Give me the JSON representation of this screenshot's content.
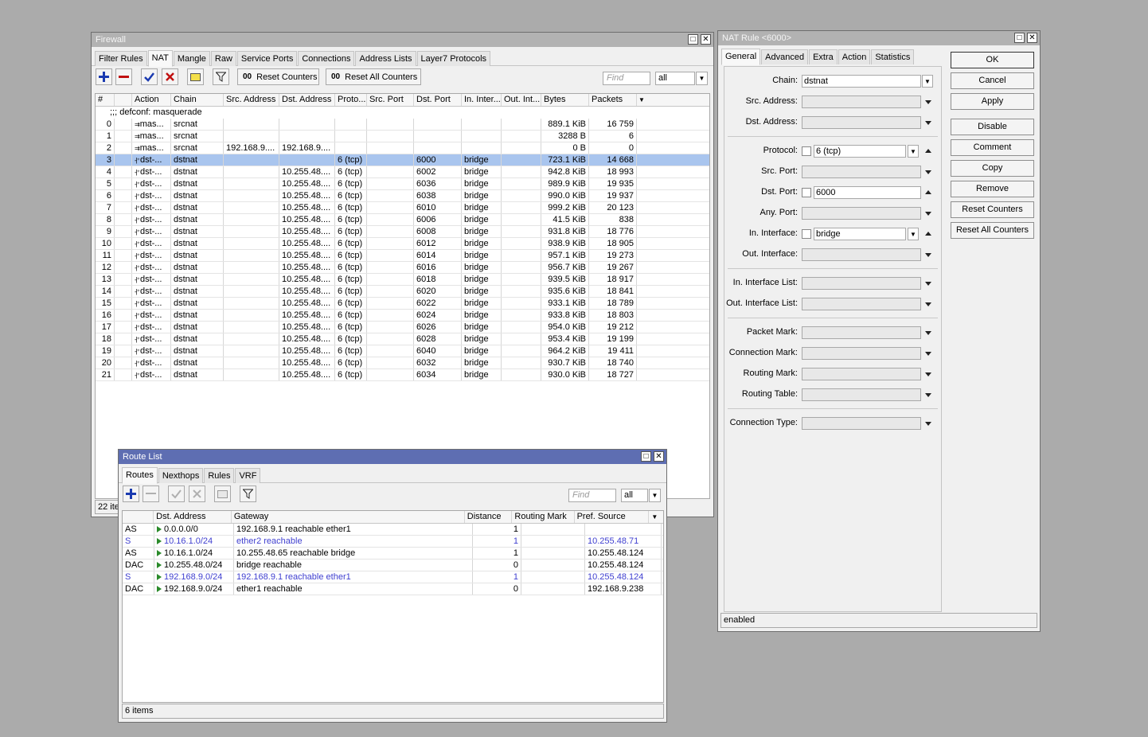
{
  "firewall": {
    "title": "Firewall",
    "tabs": [
      "Filter Rules",
      "NAT",
      "Mangle",
      "Raw",
      "Service Ports",
      "Connections",
      "Address Lists",
      "Layer7 Protocols"
    ],
    "reset_counters": "Reset Counters",
    "reset_all_counters": "Reset All Counters",
    "counter_icon": "00",
    "find_placeholder": "Find",
    "filter_value": "all",
    "columns": [
      "#",
      "",
      "Action",
      "Chain",
      "Src. Address",
      "Dst. Address",
      "Proto...",
      "Src. Port",
      "Dst. Port",
      "In. Inter...",
      "Out. Int...",
      "Bytes",
      "Packets"
    ],
    "comment": ";;; defconf: masquerade",
    "rows": [
      [
        "0",
        "",
        "mas...",
        "srcnat",
        "",
        "",
        "",
        "",
        "",
        "",
        "",
        "889.1 KiB",
        "16 759"
      ],
      [
        "1",
        "",
        "mas...",
        "srcnat",
        "",
        "",
        "",
        "",
        "",
        "",
        "",
        "3288 B",
        "6"
      ],
      [
        "2",
        "",
        "mas...",
        "srcnat",
        "192.168.9....",
        "192.168.9....",
        "",
        "",
        "",
        "",
        "",
        "0 B",
        "0"
      ],
      [
        "3",
        "",
        "dst-...",
        "dstnat",
        "",
        "",
        "6 (tcp)",
        "",
        "6000",
        "bridge",
        "",
        "723.1 KiB",
        "14 668"
      ],
      [
        "4",
        "",
        "dst-...",
        "dstnat",
        "",
        "10.255.48....",
        "6 (tcp)",
        "",
        "6002",
        "bridge",
        "",
        "942.8 KiB",
        "18 993"
      ],
      [
        "5",
        "",
        "dst-...",
        "dstnat",
        "",
        "10.255.48....",
        "6 (tcp)",
        "",
        "6036",
        "bridge",
        "",
        "989.9 KiB",
        "19 935"
      ],
      [
        "6",
        "",
        "dst-...",
        "dstnat",
        "",
        "10.255.48....",
        "6 (tcp)",
        "",
        "6038",
        "bridge",
        "",
        "990.0 KiB",
        "19 937"
      ],
      [
        "7",
        "",
        "dst-...",
        "dstnat",
        "",
        "10.255.48....",
        "6 (tcp)",
        "",
        "6010",
        "bridge",
        "",
        "999.2 KiB",
        "20 123"
      ],
      [
        "8",
        "",
        "dst-...",
        "dstnat",
        "",
        "10.255.48....",
        "6 (tcp)",
        "",
        "6006",
        "bridge",
        "",
        "41.5 KiB",
        "838"
      ],
      [
        "9",
        "",
        "dst-...",
        "dstnat",
        "",
        "10.255.48....",
        "6 (tcp)",
        "",
        "6008",
        "bridge",
        "",
        "931.8 KiB",
        "18 776"
      ],
      [
        "10",
        "",
        "dst-...",
        "dstnat",
        "",
        "10.255.48....",
        "6 (tcp)",
        "",
        "6012",
        "bridge",
        "",
        "938.9 KiB",
        "18 905"
      ],
      [
        "11",
        "",
        "dst-...",
        "dstnat",
        "",
        "10.255.48....",
        "6 (tcp)",
        "",
        "6014",
        "bridge",
        "",
        "957.1 KiB",
        "19 273"
      ],
      [
        "12",
        "",
        "dst-...",
        "dstnat",
        "",
        "10.255.48....",
        "6 (tcp)",
        "",
        "6016",
        "bridge",
        "",
        "956.7 KiB",
        "19 267"
      ],
      [
        "13",
        "",
        "dst-...",
        "dstnat",
        "",
        "10.255.48....",
        "6 (tcp)",
        "",
        "6018",
        "bridge",
        "",
        "939.5 KiB",
        "18 917"
      ],
      [
        "14",
        "",
        "dst-...",
        "dstnat",
        "",
        "10.255.48....",
        "6 (tcp)",
        "",
        "6020",
        "bridge",
        "",
        "935.6 KiB",
        "18 841"
      ],
      [
        "15",
        "",
        "dst-...",
        "dstnat",
        "",
        "10.255.48....",
        "6 (tcp)",
        "",
        "6022",
        "bridge",
        "",
        "933.1 KiB",
        "18 789"
      ],
      [
        "16",
        "",
        "dst-...",
        "dstnat",
        "",
        "10.255.48....",
        "6 (tcp)",
        "",
        "6024",
        "bridge",
        "",
        "933.8 KiB",
        "18 803"
      ],
      [
        "17",
        "",
        "dst-...",
        "dstnat",
        "",
        "10.255.48....",
        "6 (tcp)",
        "",
        "6026",
        "bridge",
        "",
        "954.0 KiB",
        "19 212"
      ],
      [
        "18",
        "",
        "dst-...",
        "dstnat",
        "",
        "10.255.48....",
        "6 (tcp)",
        "",
        "6028",
        "bridge",
        "",
        "953.4 KiB",
        "19 199"
      ],
      [
        "19",
        "",
        "dst-...",
        "dstnat",
        "",
        "10.255.48....",
        "6 (tcp)",
        "",
        "6040",
        "bridge",
        "",
        "964.2 KiB",
        "19 411"
      ],
      [
        "20",
        "",
        "dst-...",
        "dstnat",
        "",
        "10.255.48....",
        "6 (tcp)",
        "",
        "6032",
        "bridge",
        "",
        "930.7 KiB",
        "18 740"
      ],
      [
        "21",
        "",
        "dst-...",
        "dstnat",
        "",
        "10.255.48....",
        "6 (tcp)",
        "",
        "6034",
        "bridge",
        "",
        "930.0 KiB",
        "18 727"
      ]
    ],
    "selected_row": 3,
    "status": "22 ite"
  },
  "route_list": {
    "title": "Route List",
    "tabs": [
      "Routes",
      "Nexthops",
      "Rules",
      "VRF"
    ],
    "find_placeholder": "Find",
    "filter_value": "all",
    "columns": [
      "",
      "Dst. Address",
      "Gateway",
      "Distance",
      "Routing Mark",
      "Pref. Source"
    ],
    "rows": [
      {
        "cells": [
          "AS",
          "0.0.0.0/0",
          "192.168.9.1 reachable ether1",
          "1",
          "",
          ""
        ],
        "blue": false
      },
      {
        "cells": [
          "S",
          "10.16.1.0/24",
          "ether2 reachable",
          "1",
          "",
          "10.255.48.71"
        ],
        "blue": true
      },
      {
        "cells": [
          "AS",
          "10.16.1.0/24",
          "10.255.48.65 reachable bridge",
          "1",
          "",
          "10.255.48.124"
        ],
        "blue": false
      },
      {
        "cells": [
          "DAC",
          "10.255.48.0/24",
          "bridge reachable",
          "0",
          "",
          "10.255.48.124"
        ],
        "blue": false
      },
      {
        "cells": [
          "S",
          "192.168.9.0/24",
          "192.168.9.1 reachable ether1",
          "1",
          "",
          "10.255.48.124"
        ],
        "blue": true
      },
      {
        "cells": [
          "DAC",
          "192.168.9.0/24",
          "ether1 reachable",
          "0",
          "",
          "192.168.9.238"
        ],
        "blue": false
      }
    ],
    "status": "6 items"
  },
  "nat_rule": {
    "title": "NAT Rule <6000>",
    "tabs": [
      "General",
      "Advanced",
      "Extra",
      "Action",
      "Statistics"
    ],
    "labels": {
      "chain": "Chain:",
      "src_address": "Src. Address:",
      "dst_address": "Dst. Address:",
      "protocol": "Protocol:",
      "src_port": "Src. Port:",
      "dst_port": "Dst. Port:",
      "any_port": "Any. Port:",
      "in_interface": "In. Interface:",
      "out_interface": "Out. Interface:",
      "in_interface_list": "In. Interface List:",
      "out_interface_list": "Out. Interface List:",
      "packet_mark": "Packet Mark:",
      "connection_mark": "Connection Mark:",
      "routing_mark": "Routing Mark:",
      "routing_table": "Routing Table:",
      "connection_type": "Connection Type:"
    },
    "values": {
      "chain": "dstnat",
      "protocol": "6 (tcp)",
      "dst_port": "6000",
      "in_interface": "bridge"
    },
    "buttons": [
      "OK",
      "Cancel",
      "Apply",
      "Disable",
      "Comment",
      "Copy",
      "Remove",
      "Reset Counters",
      "Reset All Counters"
    ],
    "status": "enabled"
  }
}
